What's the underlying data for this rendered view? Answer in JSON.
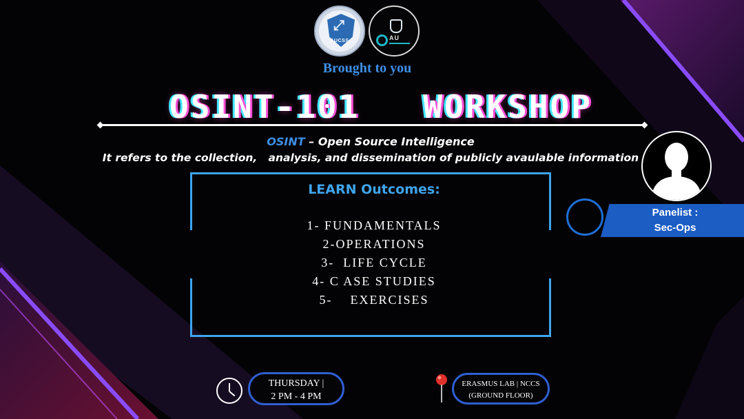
{
  "header": {
    "logo_text": "AUCSS",
    "logo2_text": "AU",
    "brought": "Brought to you"
  },
  "title": "OSINT-101   WORKSHOP",
  "definition": {
    "keyword": "OSINT",
    "expansion": " – Open  Source  Intelligence",
    "line": "It refers to the collection,   analysis, and dissemination of publicly avaulable information"
  },
  "outcomes": {
    "title": "LEARN Outcomes:",
    "items": [
      "1- FUNDAMENTALS",
      "2-OPERATIONS",
      "3-  LIFE CYCLE",
      "4- C ASE STUDIES",
      "5-    EXERCISES"
    ]
  },
  "panelist": {
    "title": "Panelist :",
    "name": "Sec-Ops"
  },
  "time": {
    "day": "THURSDAY |",
    "hours": "2 PM  -  4 PM"
  },
  "location": {
    "line1": "ERASMUS  LAB | NCCS",
    "line2": "(GROUND FLOOR)"
  },
  "colors": {
    "accent_blue": "#3fa5ee",
    "brand_blue": "#3d8fe6",
    "band_blue": "#1c5dc4",
    "neon_pink": "#ff4fd8",
    "neon_cyan": "#3fe8ff",
    "stripe_purple": "#7a3cf0",
    "background": "#030305"
  },
  "icons": [
    "clock-icon",
    "location-pin-icon",
    "person-avatar-icon",
    "shield-logo-icon"
  ]
}
